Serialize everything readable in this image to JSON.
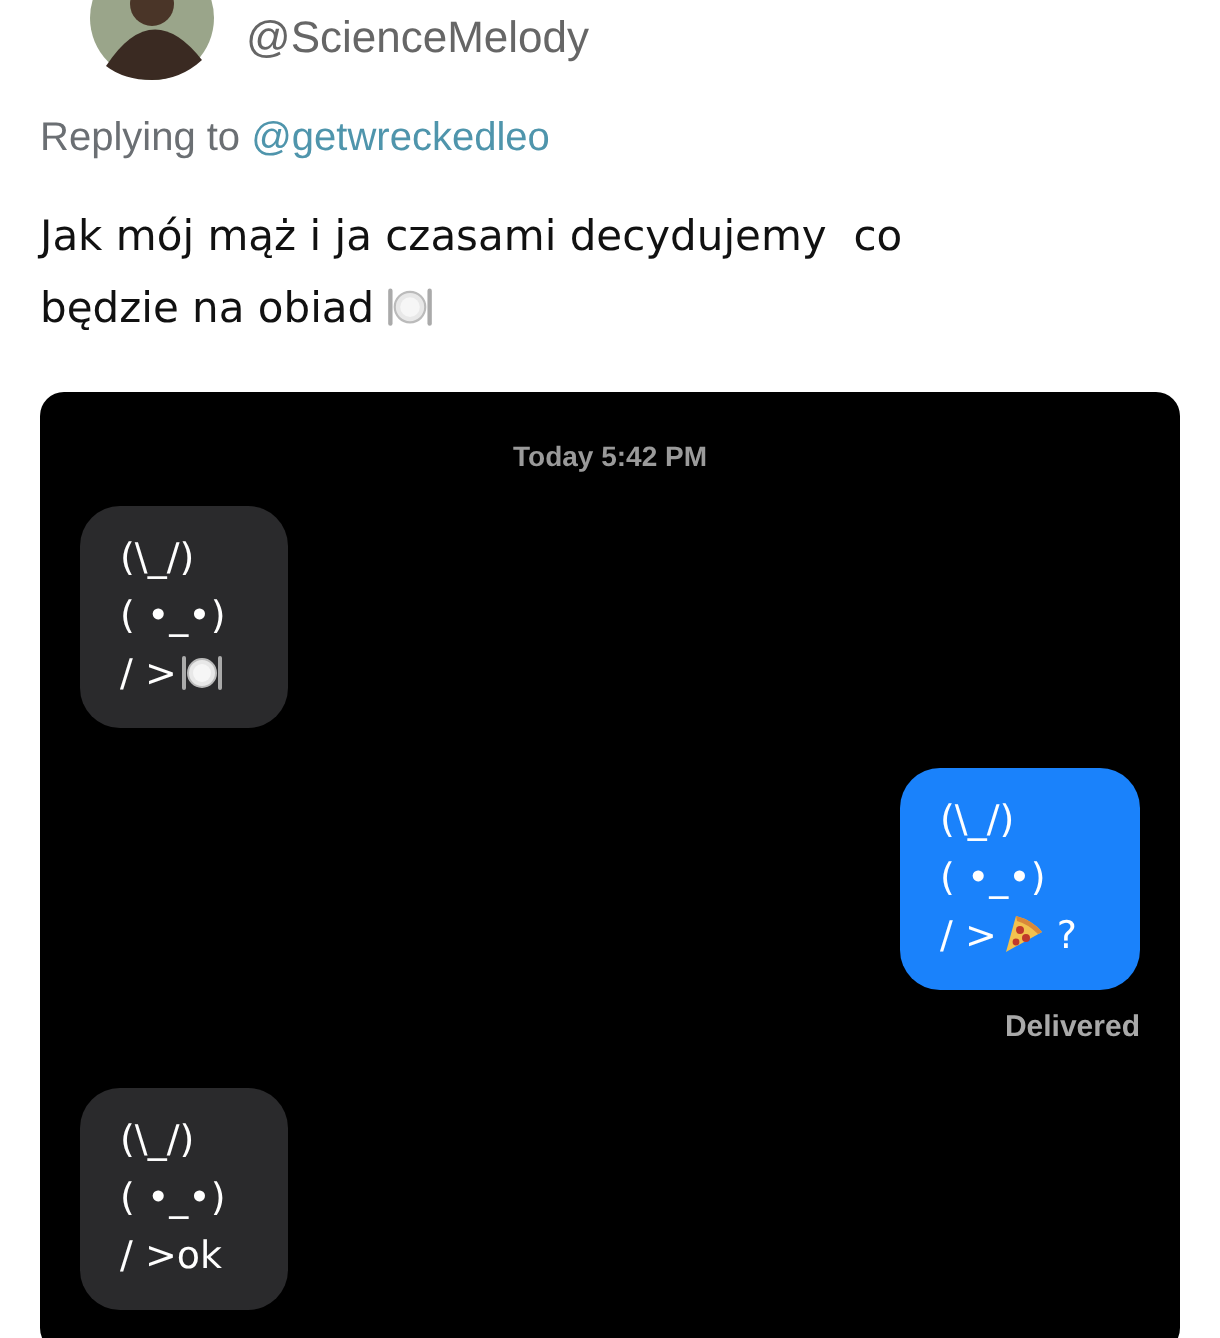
{
  "tweet": {
    "handle": "@ScienceMelody",
    "replying_label": "Replying to",
    "replying_to": "@getwreckedleo",
    "lines": [
      [
        {
          "kind": "text",
          "text": "Jak mój mąż i ja czasami decydujemy  co"
        }
      ],
      [
        {
          "kind": "text",
          "text": "będzie na obiad"
        },
        {
          "kind": "plate"
        }
      ]
    ]
  },
  "conversation": {
    "timestamp": "Today 5:42 PM",
    "messages": [
      {
        "kind": "incoming",
        "lines": [
          [
            {
              "kind": "text",
              "text": "(\\_/)"
            }
          ],
          [
            {
              "kind": "text",
              "text": "( •_•)"
            }
          ],
          [
            {
              "kind": "text",
              "text": "/ >"
            },
            {
              "kind": "plate"
            }
          ]
        ]
      },
      {
        "kind": "outgoing",
        "lines": [
          [
            {
              "kind": "text",
              "text": "(\\_/)"
            }
          ],
          [
            {
              "kind": "text",
              "text": "( •_•)"
            }
          ],
          [
            {
              "kind": "text",
              "text": "/ >"
            },
            {
              "kind": "pizza"
            },
            {
              "kind": "text",
              "text": "?"
            }
          ]
        ],
        "status": "Delivered"
      },
      {
        "kind": "incoming",
        "lines": [
          [
            {
              "kind": "text",
              "text": "(\\_/)"
            }
          ],
          [
            {
              "kind": "text",
              "text": "( •_•)"
            }
          ],
          [
            {
              "kind": "text",
              "text": "/ >ok"
            }
          ]
        ]
      }
    ]
  }
}
